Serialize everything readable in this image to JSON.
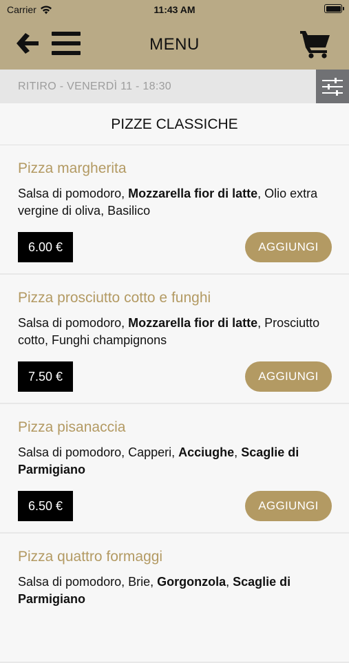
{
  "status_bar": {
    "carrier": "Carrier",
    "time": "11:43 AM"
  },
  "nav": {
    "title": "MENU"
  },
  "pickup": {
    "text": "RITIRO - VENERDÌ 11 - 18:30"
  },
  "section": {
    "title": "PIZZE CLASSICHE"
  },
  "items": [
    {
      "name": "Pizza margherita",
      "desc": [
        {
          "t": "Salsa di pomodoro, ",
          "b": false
        },
        {
          "t": "Mozzarella fior di latte",
          "b": true
        },
        {
          "t": ", Olio extra vergine di oliva, Basilico",
          "b": false
        }
      ],
      "price": "6.00 €",
      "add_label": "AGGIUNGI"
    },
    {
      "name": "Pizza prosciutto cotto e funghi",
      "desc": [
        {
          "t": "Salsa di pomodoro, ",
          "b": false
        },
        {
          "t": "Mozzarella fior di latte",
          "b": true
        },
        {
          "t": ", Prosciutto cotto, Funghi champignons",
          "b": false
        }
      ],
      "price": "7.50 €",
      "add_label": "AGGIUNGI"
    },
    {
      "name": "Pizza pisanaccia",
      "desc": [
        {
          "t": "Salsa di pomodoro, Capperi, ",
          "b": false
        },
        {
          "t": "Acciughe",
          "b": true
        },
        {
          "t": ", ",
          "b": false
        },
        {
          "t": "Scaglie di Parmigiano",
          "b": true
        }
      ],
      "price": "6.50 €",
      "add_label": "AGGIUNGI"
    },
    {
      "name": "Pizza quattro formaggi",
      "desc": [
        {
          "t": "Salsa di pomodoro, Brie, ",
          "b": false
        },
        {
          "t": "Gorgonzola",
          "b": true
        },
        {
          "t": ", ",
          "b": false
        },
        {
          "t": "Scaglie di Parmigiano",
          "b": true
        }
      ],
      "price": "",
      "add_label": ""
    }
  ],
  "colors": {
    "header_bg": "#b9aa86",
    "accent": "#b39a63",
    "filter_bg": "#707174",
    "price_bg": "#000000"
  },
  "icons": {
    "back": "arrow-left-icon",
    "menu": "hamburger-icon",
    "cart": "cart-icon",
    "filter": "sliders-icon",
    "wifi": "wifi-icon",
    "battery": "battery-icon"
  }
}
